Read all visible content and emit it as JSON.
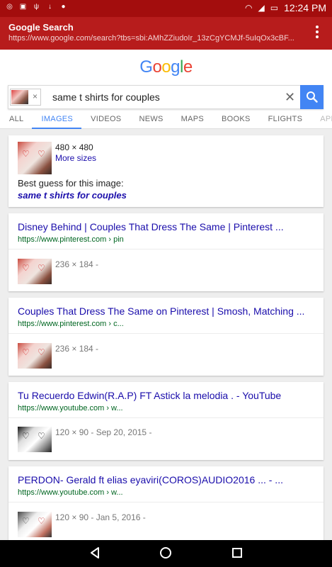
{
  "status_bar": {
    "left_icons": [
      "whatsapp-icon",
      "image-icon",
      "usb-icon",
      "download-icon",
      "android-icon"
    ],
    "time": "12:24 PM"
  },
  "toolbar": {
    "title": "Google Search",
    "url": "https://www.google.com/search?tbs=sbi:AMhZZiudoIr_13zCgYCMJf-5uIqOx3cBF..."
  },
  "google_logo": [
    "G",
    "o",
    "o",
    "g",
    "l",
    "e"
  ],
  "search": {
    "query": "same t shirts for couples",
    "chip_close": "×",
    "clear": "✕"
  },
  "tabs": [
    "ALL",
    "IMAGES",
    "VIDEOS",
    "NEWS",
    "MAPS",
    "BOOKS",
    "FLIGHTS",
    "APP"
  ],
  "active_tab": "IMAGES",
  "best_guess": {
    "size": "480 × 480",
    "more_sizes": "More sizes",
    "label": "Best guess for this image:",
    "query": "same t shirts for couples"
  },
  "results": [
    {
      "title": "Disney Behind | Couples That Dress The Same | Pinterest ...",
      "url": "https://www.pinterest.com › pin",
      "meta": "236 × 184 -"
    },
    {
      "title": "Couples That Dress The Same on Pinterest | Smosh, Matching ...",
      "url": "https://www.pinterest.com › c...",
      "meta": "236 × 184 -"
    },
    {
      "title": "Tu Recuerdo Edwin(R.A.P) FT Astick la melodia . - YouTube",
      "url": "https://www.youtube.com › w...",
      "meta": "120 × 90 - Sep 20, 2015 -"
    },
    {
      "title": "PERDON- Gerald ft elias eyaviri(COROS)AUDIO2016 ... - ...",
      "url": "https://www.youtube.com › w...",
      "meta": "120 × 90 - Jan 5, 2016 -"
    }
  ],
  "colors": {
    "status_bar": "#a30d0d",
    "toolbar": "#b71c1c",
    "link": "#1a0dab",
    "url_green": "#006621",
    "accent_blue": "#4285f4"
  }
}
